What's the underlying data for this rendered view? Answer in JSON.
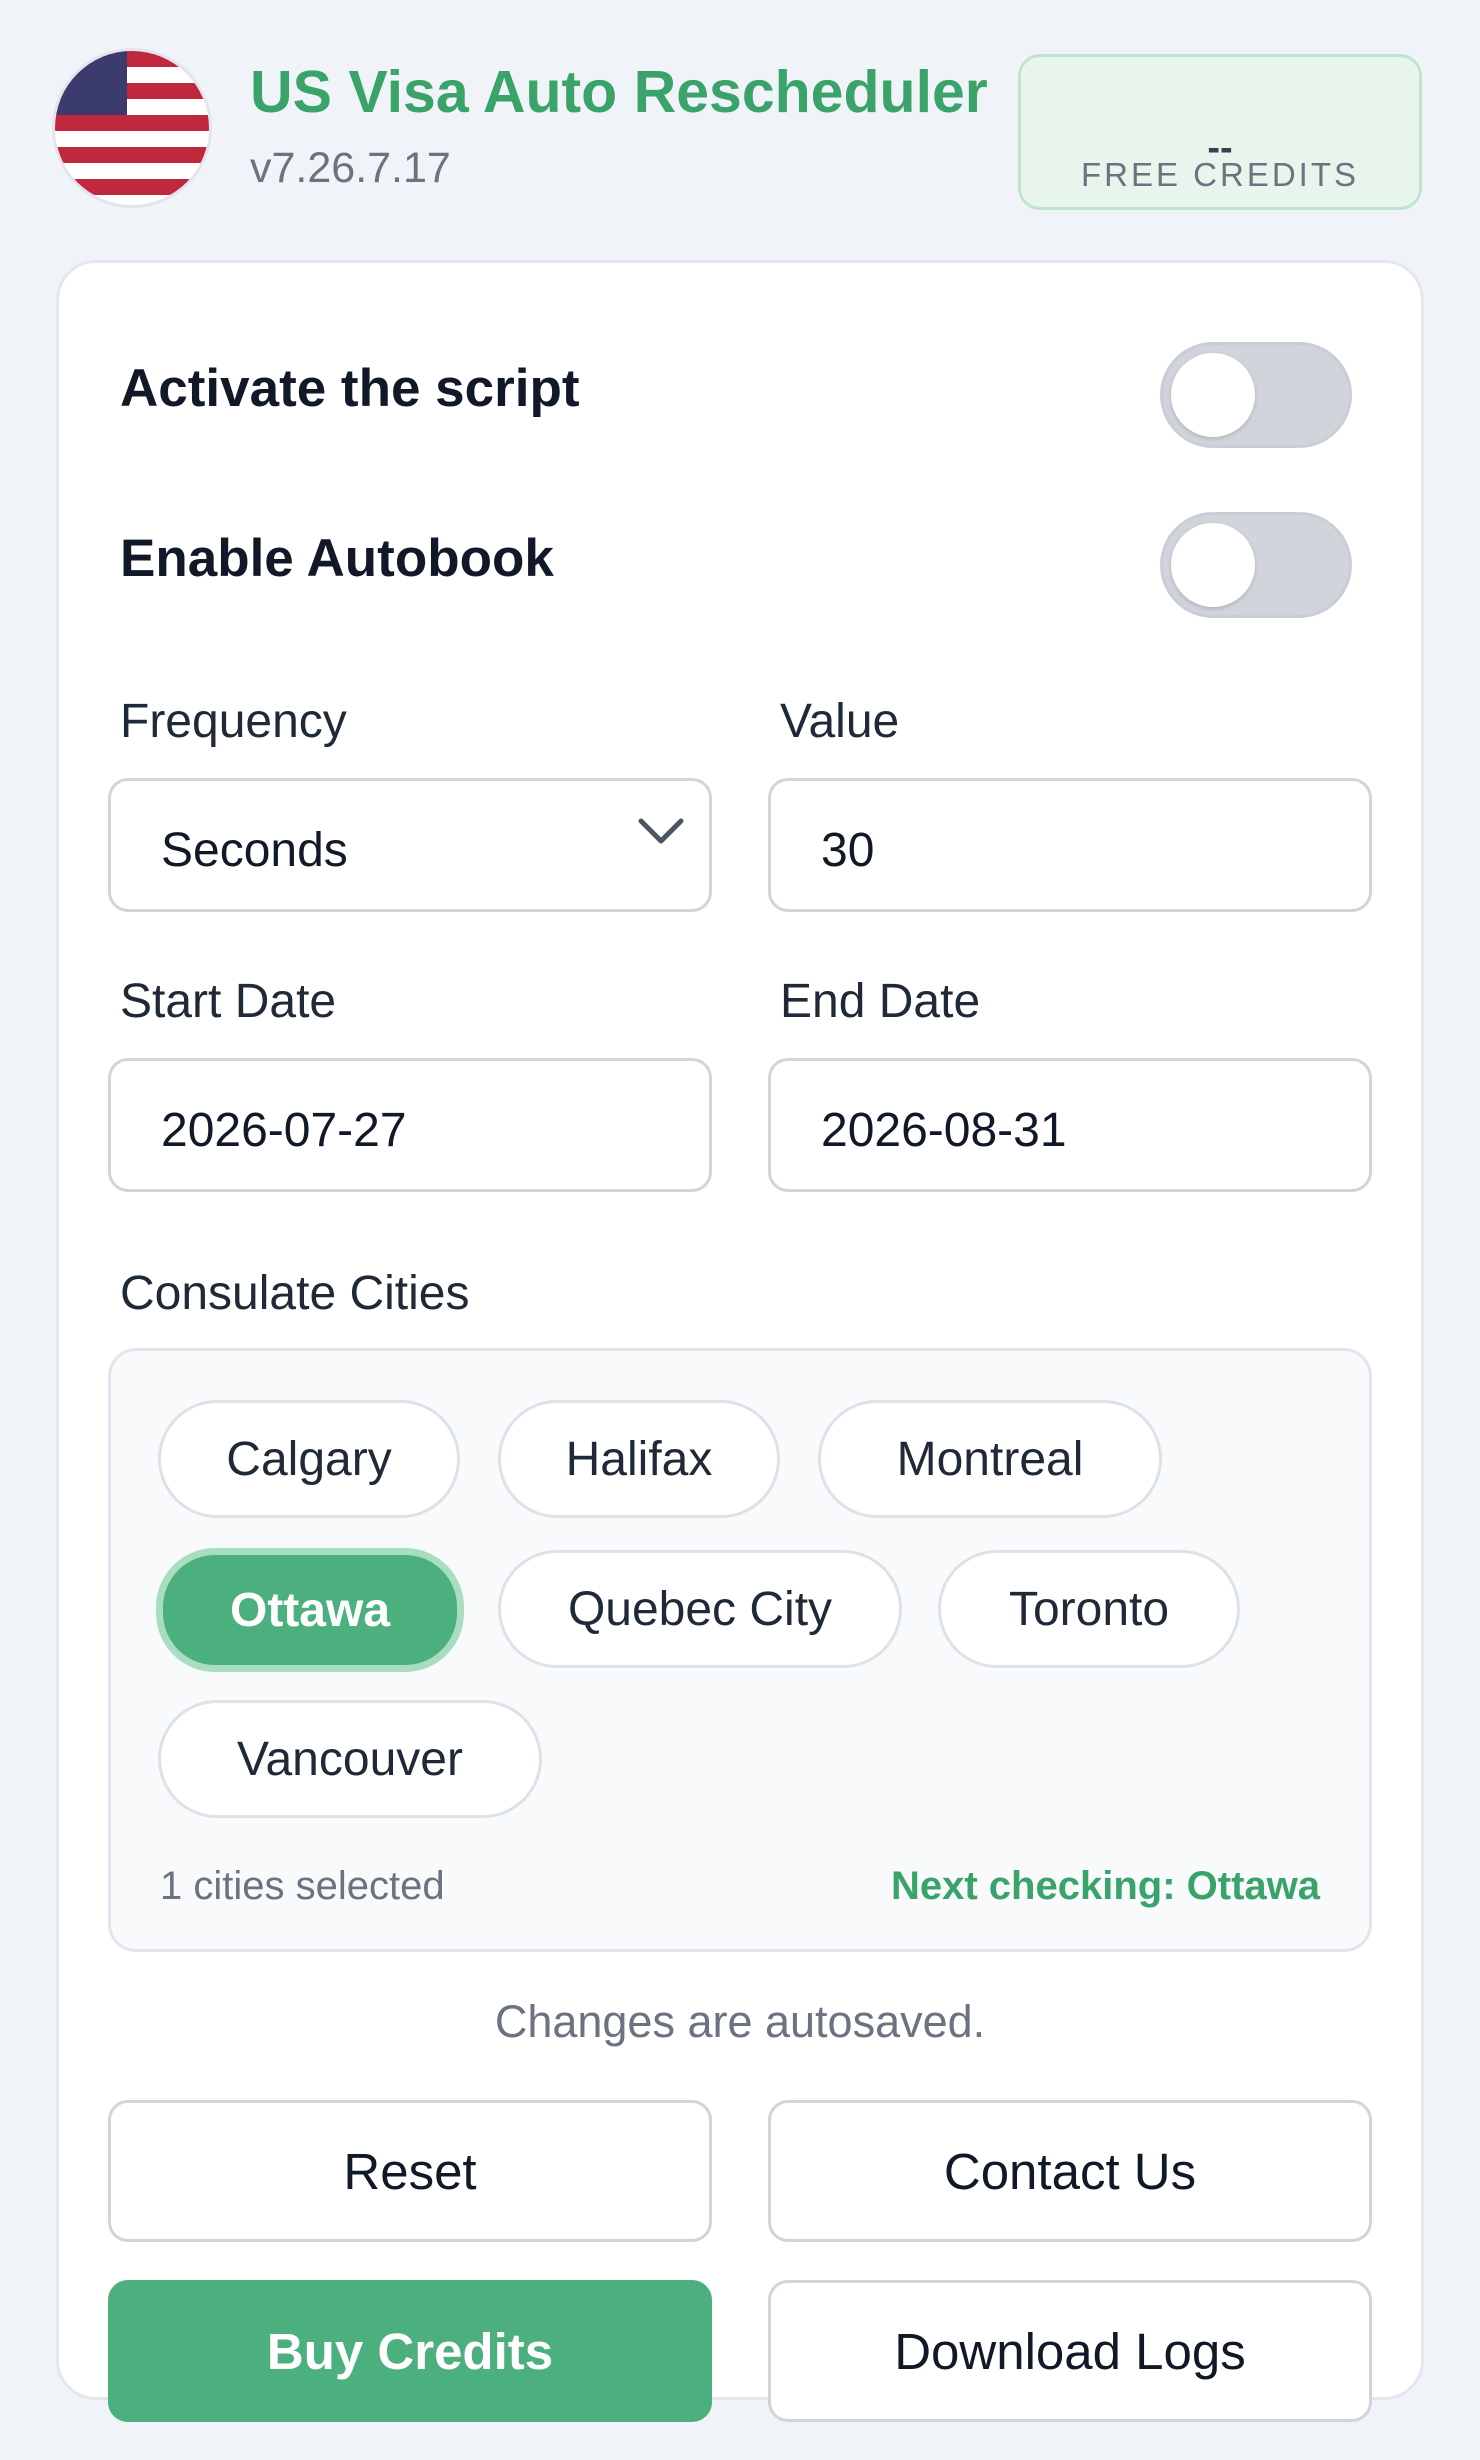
{
  "header": {
    "title": "US Visa Auto Rescheduler",
    "version": "v7.26.7.17",
    "flag_icon": "us-flag-icon",
    "credits": {
      "value": "--",
      "label": "FREE CREDITS"
    }
  },
  "toggles": {
    "activate": {
      "label": "Activate the script",
      "on": false
    },
    "autobook": {
      "label": "Enable Autobook",
      "on": false
    }
  },
  "frequency": {
    "label": "Frequency",
    "selected": "Seconds"
  },
  "value": {
    "label": "Value",
    "value": "30"
  },
  "start_date": {
    "label": "Start Date",
    "value": "2026-07-27"
  },
  "end_date": {
    "label": "End Date",
    "value": "2026-08-31"
  },
  "consulates": {
    "label": "Consulate Cities",
    "cities": [
      "Calgary",
      "Halifax",
      "Montreal",
      "Ottawa",
      "Quebec City",
      "Toronto",
      "Vancouver"
    ],
    "selected": [
      "Ottawa"
    ],
    "count_text": "1 cities selected",
    "next_checking": "Next checking: Ottawa"
  },
  "autosave_note": "Changes are autosaved.",
  "buttons": {
    "reset": "Reset",
    "contact": "Contact Us",
    "buy": "Buy Credits",
    "download": "Download Logs"
  },
  "colors": {
    "brand_green": "#3aa36a",
    "selected_chip": "#4caf7e",
    "toggle_off": "#d1d5db",
    "background": "#f0f4f8"
  }
}
